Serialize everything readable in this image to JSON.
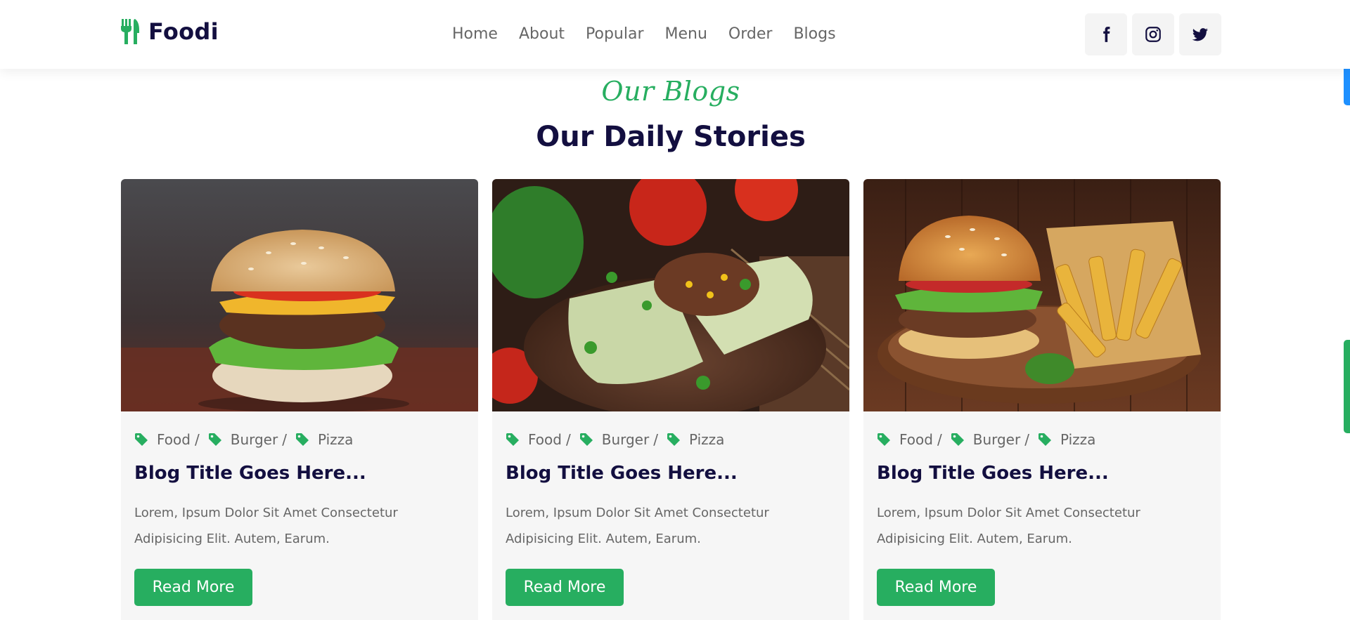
{
  "brand": {
    "name": "Foodi"
  },
  "nav": {
    "items": [
      "Home",
      "About",
      "Popular",
      "Menu",
      "Order",
      "Blogs"
    ]
  },
  "socials": [
    "facebook-icon",
    "instagram-icon",
    "twitter-icon"
  ],
  "section": {
    "subtitle": "Our Blogs",
    "title": "Our Daily Stories"
  },
  "cards": [
    {
      "tags": [
        "Food",
        "Burger",
        "Pizza"
      ],
      "title": "Blog Title Goes Here...",
      "text": "Lorem, Ipsum Dolor Sit Amet Consectetur Adipisicing Elit. Autem, Earum.",
      "button": "Read More",
      "image": "burger-photo"
    },
    {
      "tags": [
        "Food",
        "Burger",
        "Pizza"
      ],
      "title": "Blog Title Goes Here...",
      "text": "Lorem, Ipsum Dolor Sit Amet Consectetur Adipisicing Elit. Autem, Earum.",
      "button": "Read More",
      "image": "wrap-photo"
    },
    {
      "tags": [
        "Food",
        "Burger",
        "Pizza"
      ],
      "title": "Blog Title Goes Here...",
      "text": "Lorem, Ipsum Dolor Sit Amet Consectetur Adipisicing Elit. Autem, Earum.",
      "button": "Read More",
      "image": "burger-fries-photo"
    }
  ],
  "colors": {
    "accent": "#27ae60",
    "dark": "#130f40",
    "muted": "#666666",
    "card_bg": "#f6f6f6",
    "scroll_blue": "#1e90ff"
  }
}
